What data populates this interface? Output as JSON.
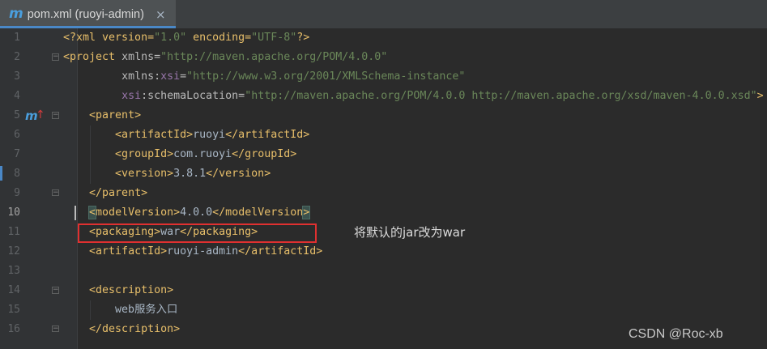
{
  "tab": {
    "icon": "maven-icon",
    "title": "pom.xml (ruoyi-admin)",
    "close": "×"
  },
  "gutter": {
    "maven_marker_icon": "maven-override-icon",
    "marker_label": "m",
    "marker_arrow": "↑"
  },
  "lines": {
    "l1": {
      "num": "1",
      "p1": "<?xml version=",
      "v1": "\"1.0\"",
      "p2": " encoding=",
      "v2": "\"UTF-8\"",
      "p3": "?>"
    },
    "l2": {
      "num": "2",
      "t1": "<project ",
      "a1": "xmlns=",
      "v1": "\"http://maven.apache.org/POM/4.0.0\""
    },
    "l3": {
      "num": "3",
      "indent": "         ",
      "a1": "xmlns:",
      "ns1": "xsi",
      "a2": "=",
      "v1": "\"http://www.w3.org/2001/XMLSchema-instance\""
    },
    "l4": {
      "num": "4",
      "indent": "         ",
      "ns1": "xsi",
      "a1": ":schemaLocation=",
      "v1": "\"http://maven.apache.org/POM/4.0.0 http://maven.apache.org/xsd/maven-4.0.0.xsd\"",
      "t1": ">"
    },
    "l5": {
      "num": "5",
      "indent": "    ",
      "t1": "<parent>"
    },
    "l6": {
      "num": "6",
      "indent": "        ",
      "t1": "<artifactId>",
      "text": "ruoyi",
      "t2": "</artifactId>"
    },
    "l7": {
      "num": "7",
      "indent": "        ",
      "t1": "<groupId>",
      "text": "com.ruoyi",
      "t2": "</groupId>"
    },
    "l8": {
      "num": "8",
      "indent": "        ",
      "t1": "<version>",
      "text": "3.8.1",
      "t2": "</version>"
    },
    "l9": {
      "num": "9",
      "indent": "    ",
      "t1": "</parent>"
    },
    "l10": {
      "num": "10",
      "indent": "    ",
      "t1a": "<",
      "t1b": "modelVersion",
      "t1c": ">",
      "text": "4.0.0",
      "t2a": "</modelVersion",
      "t2b": ">"
    },
    "l11": {
      "num": "11",
      "indent": "    ",
      "t1": "<packaging>",
      "text": "war",
      "t2": "</packaging>"
    },
    "l12": {
      "num": "12",
      "indent": "    ",
      "t1": "<artifactId>",
      "text": "ruoyi-admin",
      "t2": "</artifactId>"
    },
    "l13": {
      "num": "13"
    },
    "l14": {
      "num": "14",
      "indent": "    ",
      "t1": "<description>"
    },
    "l15": {
      "num": "15",
      "indent": "        ",
      "text": "web服务入口"
    },
    "l16": {
      "num": "16",
      "indent": "    ",
      "t1": "</description>"
    }
  },
  "annotation": {
    "text": "将默认的jar改为war",
    "box_color": "#e03030"
  },
  "watermark": "CSDN @Roc-xb",
  "colors": {
    "background": "#2b2b2b",
    "tag": "#e8bf6a",
    "attribute_value": "#6a8759",
    "namespace": "#9876aa",
    "text": "#a9b7c6",
    "accent": "#4a88c7"
  }
}
